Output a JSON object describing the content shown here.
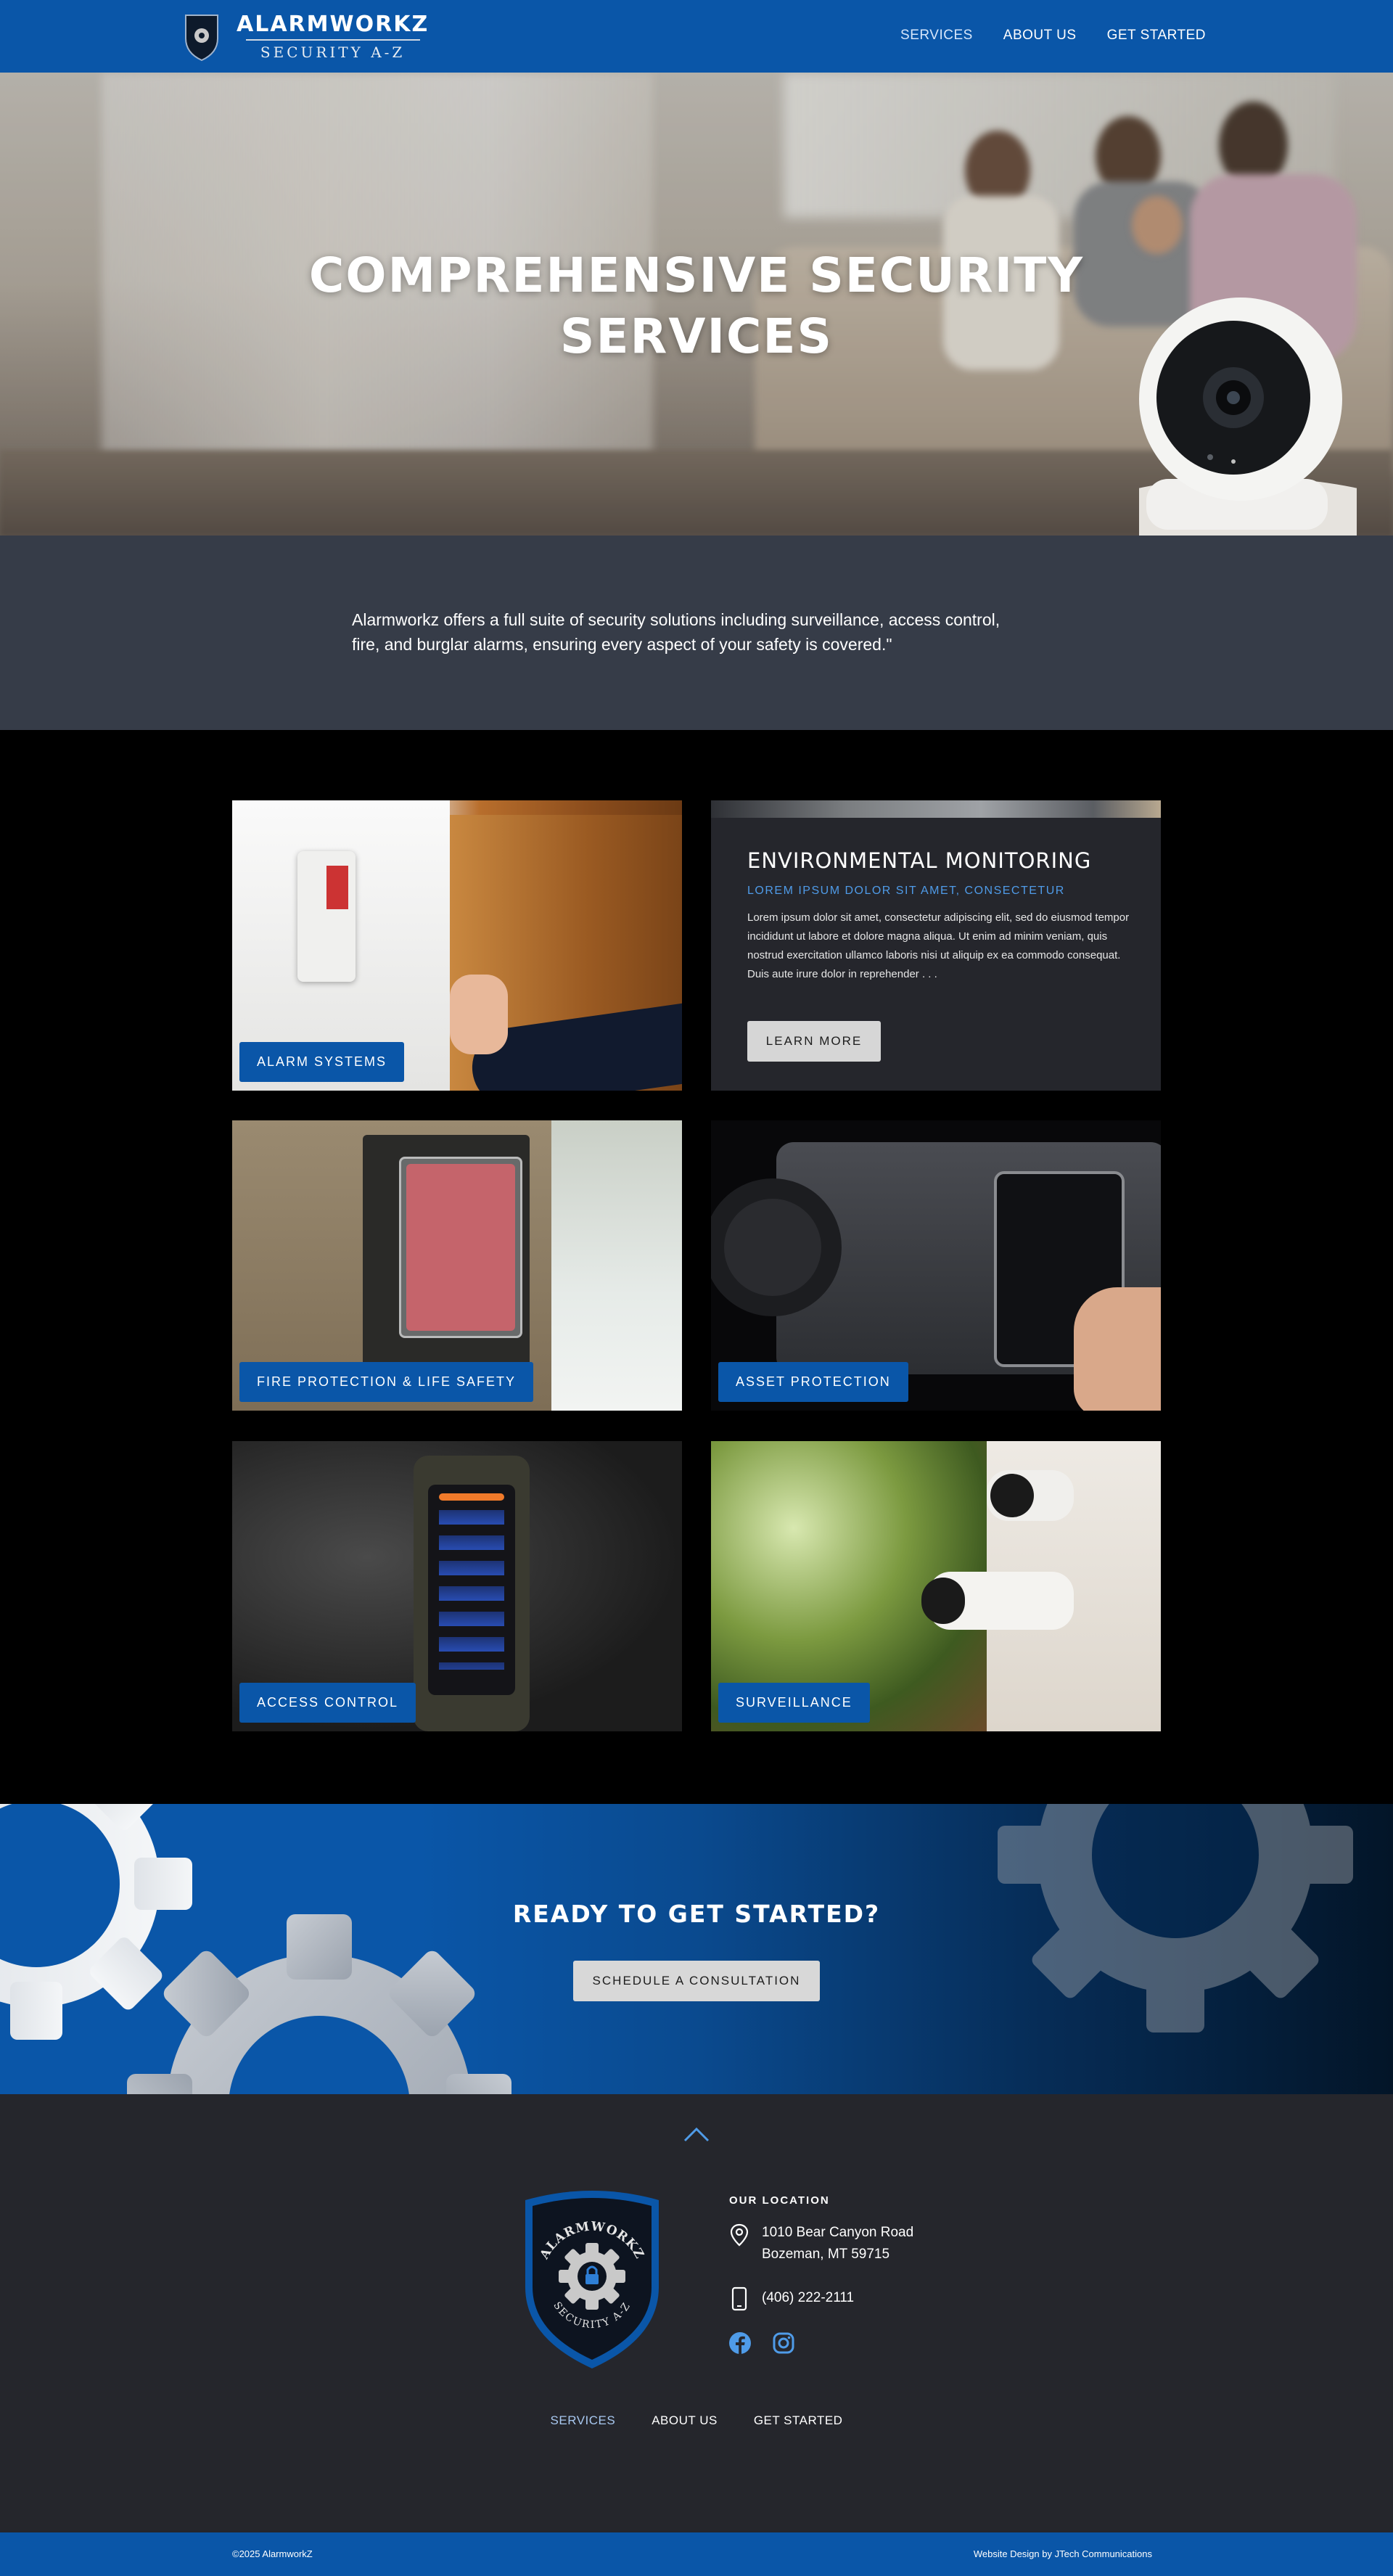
{
  "brand": {
    "name": "ALARMWORKZ",
    "tagline": "SECURITY A-Z",
    "badge_top_text": "ALARMWORKZ",
    "badge_bottom_text": "SECURITY A-Z",
    "primary_color": "#0a56a8",
    "accent_color": "#4f9be8"
  },
  "nav": {
    "items": [
      {
        "label": "SERVICES",
        "active": true
      },
      {
        "label": "ABOUT US",
        "active": false
      },
      {
        "label": "GET STARTED",
        "active": false
      }
    ]
  },
  "hero": {
    "title_line1": "COMPREHENSIVE SECURITY",
    "title_line2": "SERVICES"
  },
  "intro": {
    "text": "Alarmworkz offers a full suite of security solutions including surveillance, access control, fire, and burglar alarms, ensuring every aspect of your safety is covered.\""
  },
  "services": {
    "tiles": [
      {
        "label": "ALARM SYSTEMS"
      },
      {
        "label": "FIRE PROTECTION & LIFE SAFETY"
      },
      {
        "label": "ASSET PROTECTION"
      },
      {
        "label": "ACCESS CONTROL"
      },
      {
        "label": "SURVEILLANCE"
      }
    ],
    "featured": {
      "title": "ENVIRONMENTAL MONITORING",
      "subtitle": "LOREM IPSUM DOLOR SIT AMET, CONSECTETUR",
      "body": "Lorem ipsum dolor sit amet, consectetur adipiscing elit, sed do eiusmod tempor incididunt ut labore et dolore magna aliqua. Ut enim ad minim veniam, quis nostrud exercitation ullamco laboris nisi ut aliquip ex ea commodo consequat. Duis aute irure dolor in reprehender . . .",
      "button_label": "LEARN MORE"
    }
  },
  "cta": {
    "title": "READY TO GET STARTED?",
    "button_label": "SCHEDULE A CONSULTATION"
  },
  "footer": {
    "location_heading": "OUR LOCATION",
    "address_line1": "1010 Bear Canyon Road",
    "address_line2": "Bozeman, MT 59715",
    "phone": "(406) 222-2111",
    "social": [
      "facebook-icon",
      "instagram-icon"
    ],
    "nav": [
      {
        "label": "SERVICES",
        "active": true
      },
      {
        "label": "ABOUT US",
        "active": false
      },
      {
        "label": "GET STARTED",
        "active": false
      }
    ]
  },
  "bottom_bar": {
    "copyright": "©2025 AlarmworkZ",
    "credit": "Website Design by JTech Communications"
  }
}
